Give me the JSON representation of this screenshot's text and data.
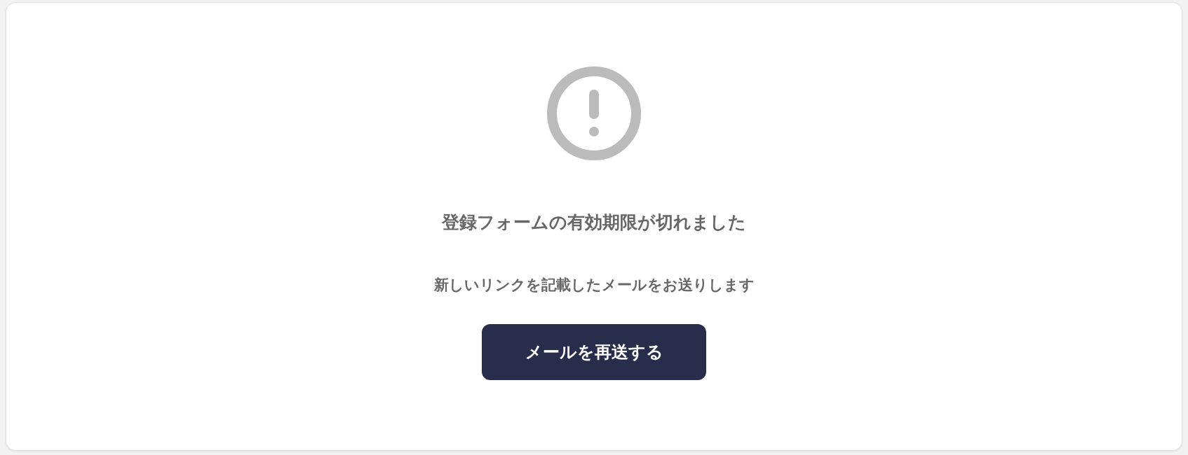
{
  "title": "登録フォームの有効期限が切れました",
  "message": "新しいリンクを記載したメールをお送りします",
  "button": {
    "label": "メールを再送する"
  }
}
